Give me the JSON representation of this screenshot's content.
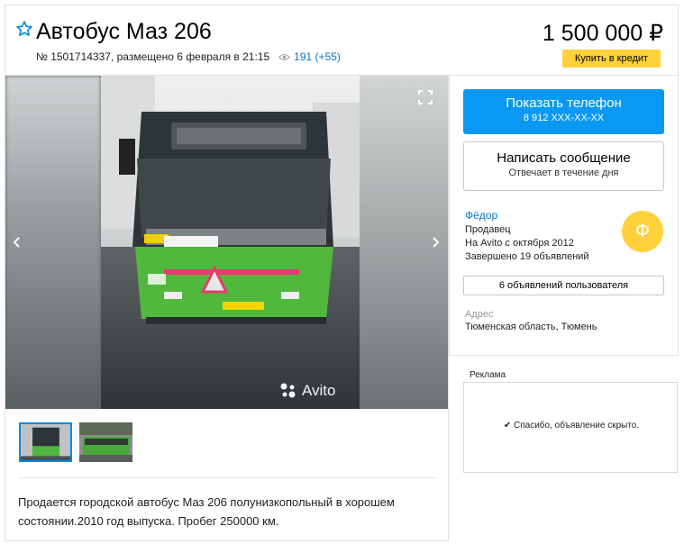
{
  "header": {
    "favorite_icon": "star-outline-icon",
    "title": "Автобус Маз 206",
    "meta": "№ 1501714337, размещено 6 февраля в 21:15",
    "views_icon": "eye-icon",
    "views": "191 (+55)",
    "price": "1 500 000 ₽",
    "credit_button": "Купить в кредит"
  },
  "gallery": {
    "prev_icon": "chevron-left-icon",
    "next_icon": "chevron-right-icon",
    "fullscreen_icon": "fullscreen-icon",
    "watermark": "Avito",
    "thumbnails_count": 2
  },
  "description": "Продается городской автобус Маз 206 полунизкопольный в хорошем состоянии.2010 год выпуска. Пробег 250000 км.",
  "contact": {
    "phone_button_title": "Показать телефон",
    "phone_button_number": "8 912 XXX-XX-XX",
    "message_button_title": "Написать сообщение",
    "message_button_subtitle": "Отвечает в течение дня"
  },
  "seller": {
    "name": "Фёдор",
    "role": "Продавец",
    "since": "На Avito с октября 2012",
    "completed": "Завершено 19 объявлений",
    "avatar_letter": "Ф",
    "user_ads_button": "6 объявлений пользователя",
    "address_label": "Адрес",
    "address": "Тюменская область, Тюмень"
  },
  "ad": {
    "label": "Реклама",
    "message": "✔ Спасибо, объявление скрыто."
  },
  "colors": {
    "link": "#0a75c9",
    "phone_button": "#0a99f2",
    "credit_button": "#ffd23c",
    "avatar": "#ffd23c",
    "bus_green": "#4fb83d"
  }
}
